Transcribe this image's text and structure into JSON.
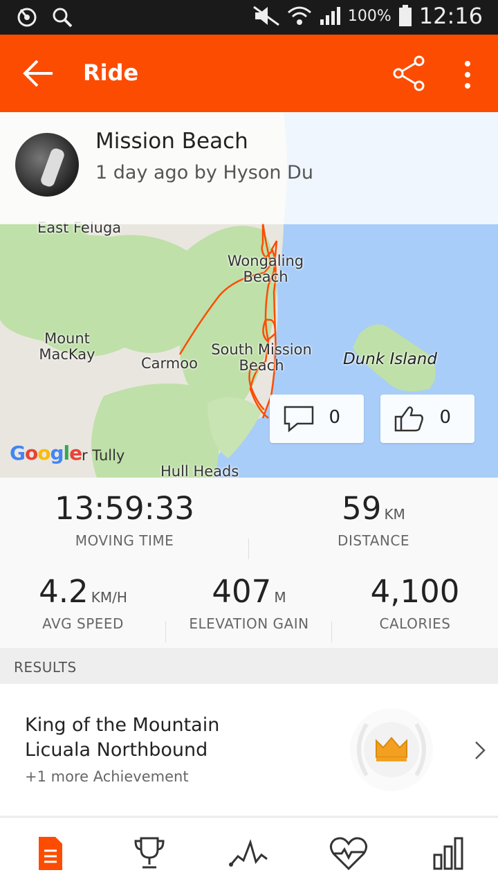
{
  "status_bar": {
    "battery": "100%",
    "time": "12:16"
  },
  "app_bar": {
    "title": "Ride",
    "back_icon": "arrow-left-icon",
    "share_icon": "share-icon",
    "more_icon": "more-vertical-icon"
  },
  "header": {
    "activity_name": "Mission Beach",
    "meta": "1 day ago by Hyson Du"
  },
  "map": {
    "labels": {
      "east_feluga": "East Feluga",
      "wongaling_1": "Wongaling",
      "wongaling_2": "Beach",
      "mount_1": "Mount",
      "mount_2": "MacKay",
      "carmoo": "Carmoo",
      "south_mission_1": "South Mission",
      "south_mission_2": "Beach",
      "dunk_island": "Dunk Island",
      "tully": "r Tully",
      "hull_heads": "Hull Heads"
    },
    "google_logo": "Google",
    "colors": {
      "water": "#a8cdf8",
      "land": "#e9e6df",
      "forest": "#bfe0a8",
      "route": "#fc4c02"
    }
  },
  "social": {
    "comments": "0",
    "likes": "0"
  },
  "stats": {
    "moving_time": {
      "value": "13:59:33",
      "label": "MOVING TIME"
    },
    "distance": {
      "value": "59",
      "unit": "KM",
      "label": "DISTANCE"
    },
    "avg_speed": {
      "value": "4.2",
      "unit": "KM/H",
      "label": "AVG SPEED"
    },
    "elevation": {
      "value": "407",
      "unit": "M",
      "label": "ELEVATION GAIN"
    },
    "calories": {
      "value": "4,100",
      "label": "CALORIES"
    }
  },
  "results": {
    "heading": "RESULTS",
    "line1": "King of the Mountain",
    "line2": "Licuala Northbound",
    "line3": "+1 more Achievement"
  },
  "bottom_nav": {
    "items": [
      "overview-icon",
      "trophy-icon",
      "elevation-icon",
      "heart-rate-icon",
      "analysis-icon"
    ],
    "active_color": "#fc4c02"
  },
  "theme": {
    "brand": "#fc4c02"
  }
}
